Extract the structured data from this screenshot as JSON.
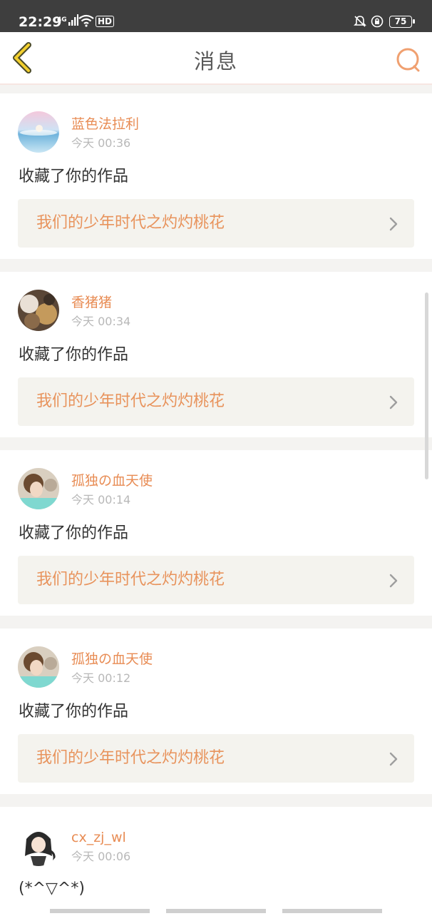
{
  "status_bar": {
    "time": "22:29",
    "network": "4G",
    "hd": "HD",
    "battery": "75"
  },
  "header": {
    "title": "消息",
    "back_icon": "back-chevron-icon",
    "search_icon": "search-icon"
  },
  "messages": [
    {
      "username": "蓝色法拉利",
      "time": "今天 00:36",
      "action": "收藏了你的作品",
      "work_title": "我们的少年时代之灼灼桃花"
    },
    {
      "username": "香猪猪",
      "time": "今天 00:34",
      "action": "收藏了你的作品",
      "work_title": "我们的少年时代之灼灼桃花"
    },
    {
      "username": "孤独の血天使",
      "time": "今天 00:14",
      "action": "收藏了你的作品",
      "work_title": "我们的少年时代之灼灼桃花"
    },
    {
      "username": "孤独の血天使",
      "time": "今天 00:12",
      "action": "收藏了你的作品",
      "work_title": "我们的少年时代之灼灼桃花"
    },
    {
      "username": "cx_zj_wl",
      "time": "今天 00:06",
      "action": "(*^▽^*)"
    }
  ],
  "colors": {
    "accent": "#e88c54",
    "header_bg": "#ffffff",
    "status_bg": "#3e3e3e"
  }
}
